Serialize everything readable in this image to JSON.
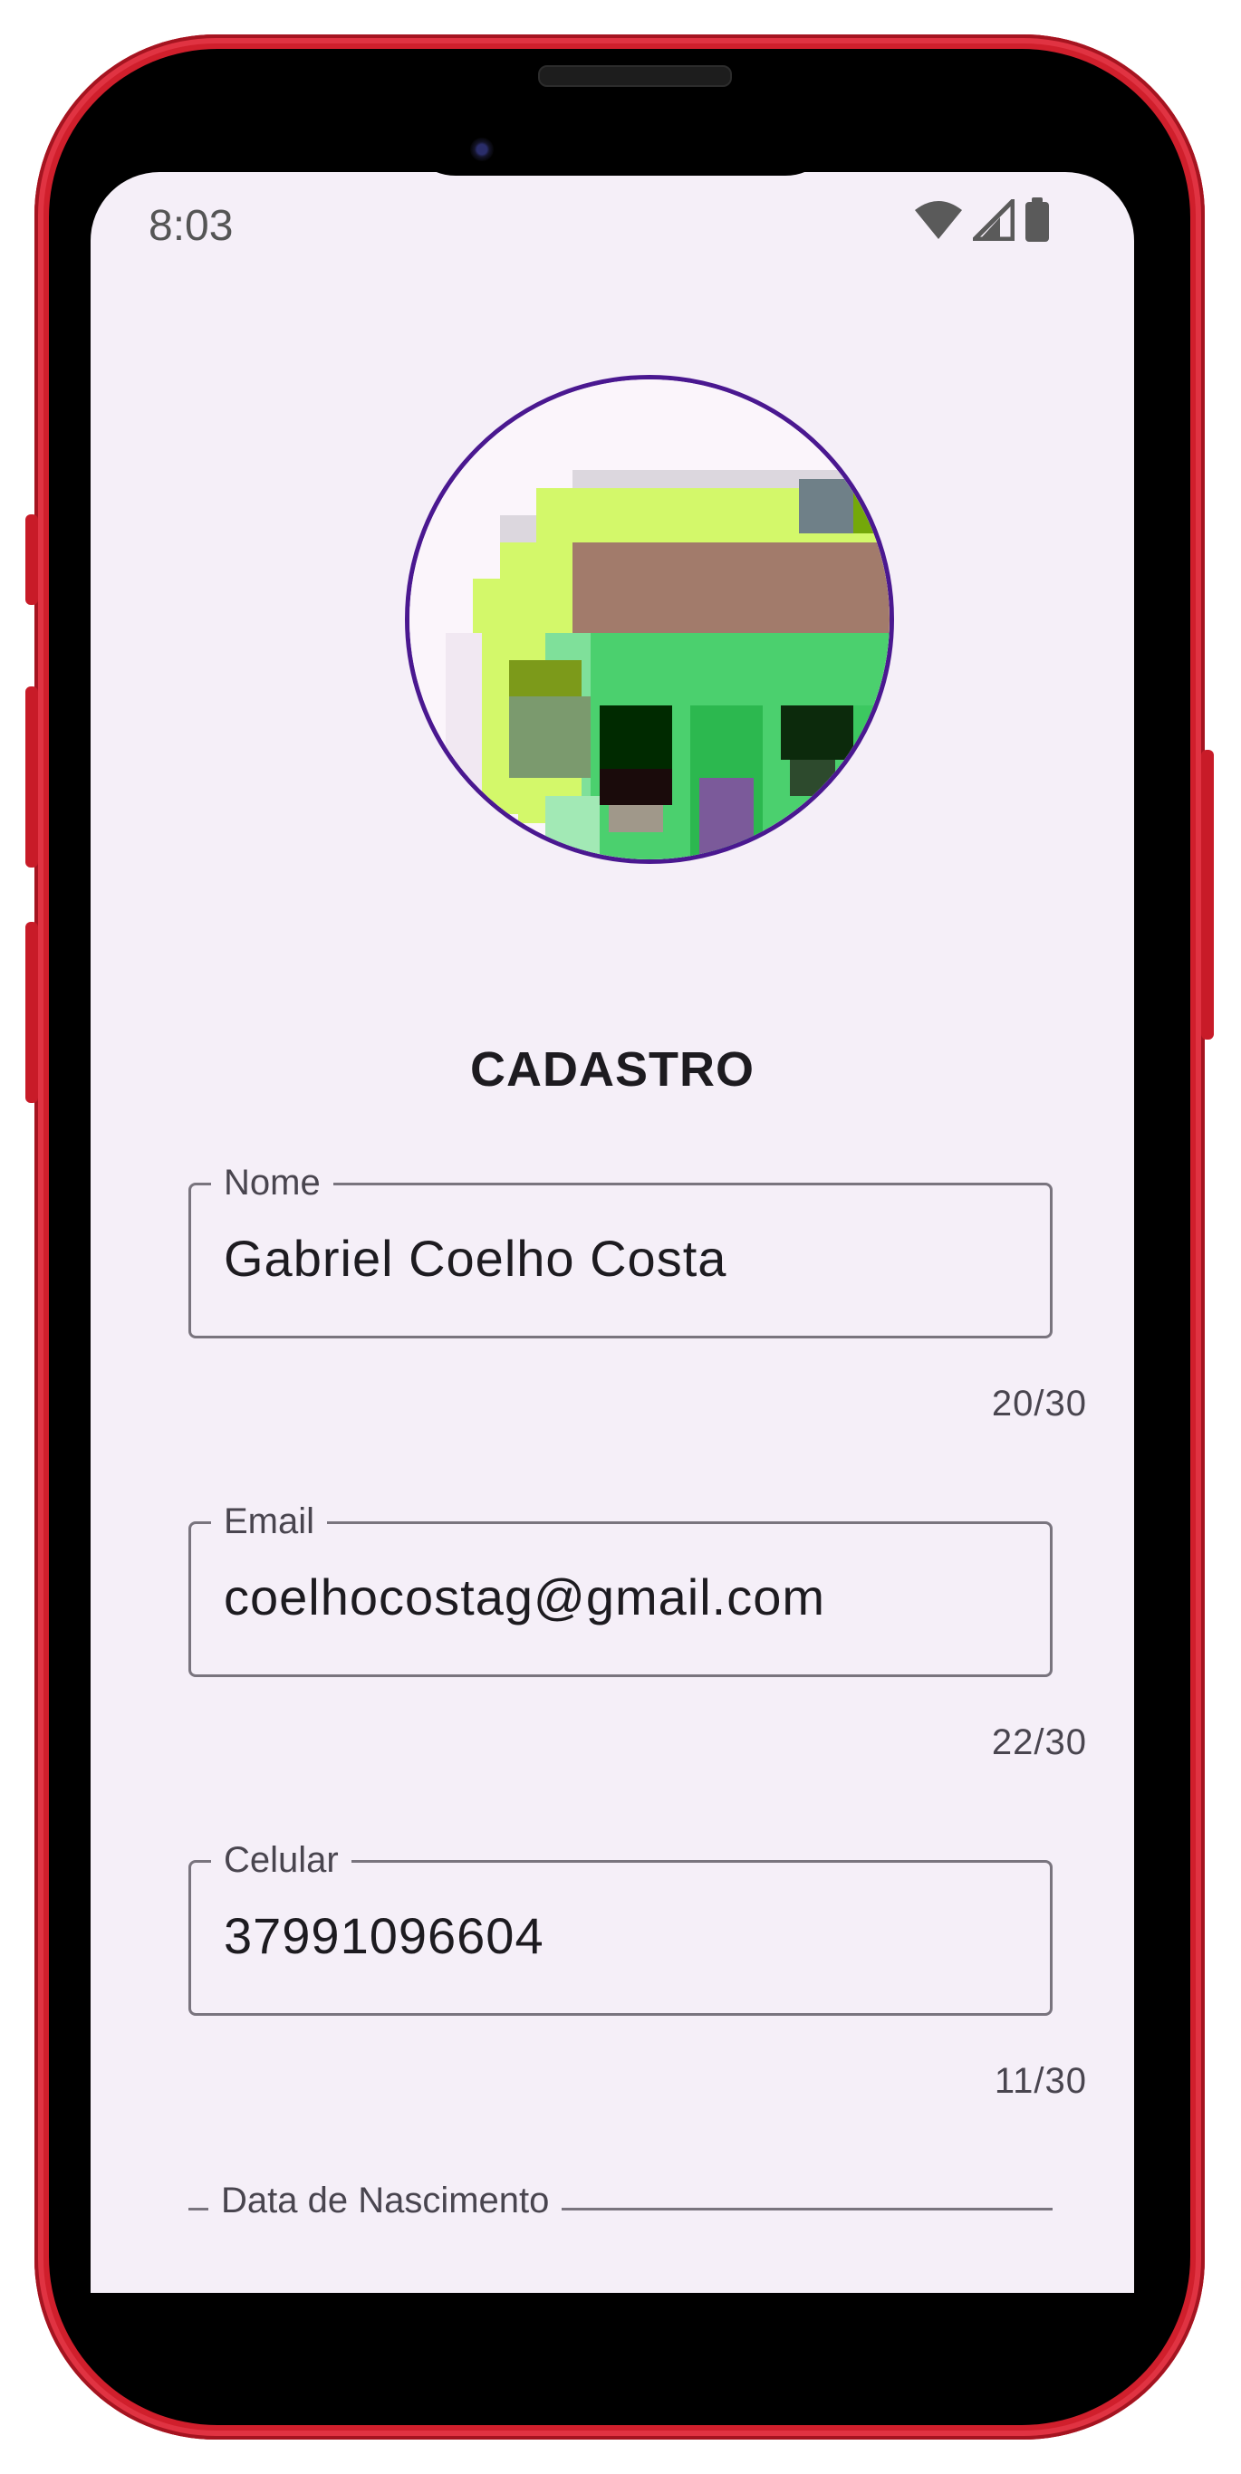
{
  "status_bar": {
    "time": "8:03",
    "icons": [
      "wifi-icon",
      "signal-icon",
      "battery-icon"
    ]
  },
  "avatar": {
    "icon": "profile-avatar-image"
  },
  "page": {
    "title": "CADASTRO"
  },
  "fields": [
    {
      "label": "Nome",
      "value": "Gabriel Coelho Costa",
      "counter": "20/30"
    },
    {
      "label": "Email",
      "value": "coelhocostag@gmail.com",
      "counter": "22/30"
    },
    {
      "label": "Celular",
      "value": "37991096604",
      "counter": "11/30"
    },
    {
      "label": "Data de Nascimento"
    }
  ],
  "colors": {
    "phone_frame": "#d01f2c",
    "screen_bg": "#f5eff8",
    "avatar_border": "#4a1890",
    "field_border": "#79747e",
    "text_primary": "#1d1b20",
    "text_secondary": "#49454f"
  }
}
